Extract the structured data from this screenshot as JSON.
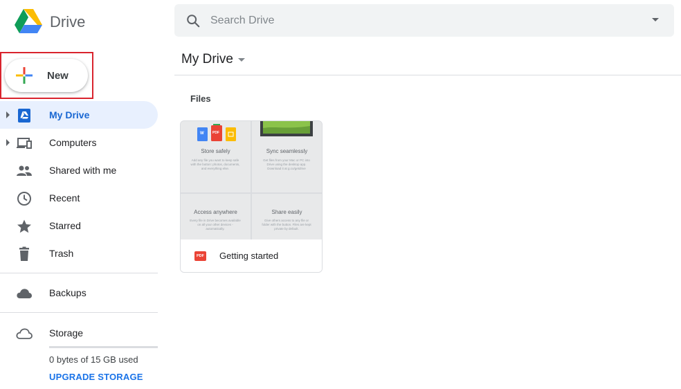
{
  "app": {
    "name": "Drive"
  },
  "search": {
    "placeholder": "Search Drive"
  },
  "new_button": {
    "label": "New"
  },
  "sidebar": {
    "items": [
      {
        "label": "My Drive",
        "icon": "my-drive-icon",
        "active": true,
        "expandable": true
      },
      {
        "label": "Computers",
        "icon": "computers-icon",
        "active": false,
        "expandable": true
      },
      {
        "label": "Shared with me",
        "icon": "shared-icon",
        "active": false,
        "expandable": false
      },
      {
        "label": "Recent",
        "icon": "clock-icon",
        "active": false,
        "expandable": false
      },
      {
        "label": "Starred",
        "icon": "star-icon",
        "active": false,
        "expandable": false
      },
      {
        "label": "Trash",
        "icon": "trash-icon",
        "active": false,
        "expandable": false
      }
    ],
    "backups": {
      "label": "Backups",
      "icon": "cloud-filled-icon"
    },
    "storage": {
      "label": "Storage",
      "icon": "cloud-outline-icon",
      "used_text": "0 bytes of 15 GB used",
      "used_fraction": 0,
      "upgrade_label": "UPGRADE STORAGE"
    }
  },
  "main": {
    "breadcrumb": "My Drive",
    "section_label": "Files",
    "files": [
      {
        "name": "Getting started",
        "type": "pdf",
        "type_badge": "PDF",
        "thumbnail": {
          "tiles": [
            {
              "title": "Store safely",
              "text": "Add any file you want to keep safe with the  button: photos, documents, and everything else."
            },
            {
              "title": "Sync seamlessly",
              "text": "Get files from your Mac or PC into Drive using the desktop app. Download it at g.co/getdrive"
            },
            {
              "title": "Access anywhere",
              "text": "Every file in Drive becomes available on all your other devices - automatically."
            },
            {
              "title": "Share easily",
              "text": "Give others access to any file or folder with the  button. Files are kept private by default."
            }
          ],
          "doc_badges": [
            "W",
            "PDF"
          ]
        }
      }
    ]
  },
  "colors": {
    "accent": "#1a73e8",
    "active_bg": "#e8f0fe",
    "highlight_border": "#d9232d",
    "pdf_red": "#ea4335"
  }
}
